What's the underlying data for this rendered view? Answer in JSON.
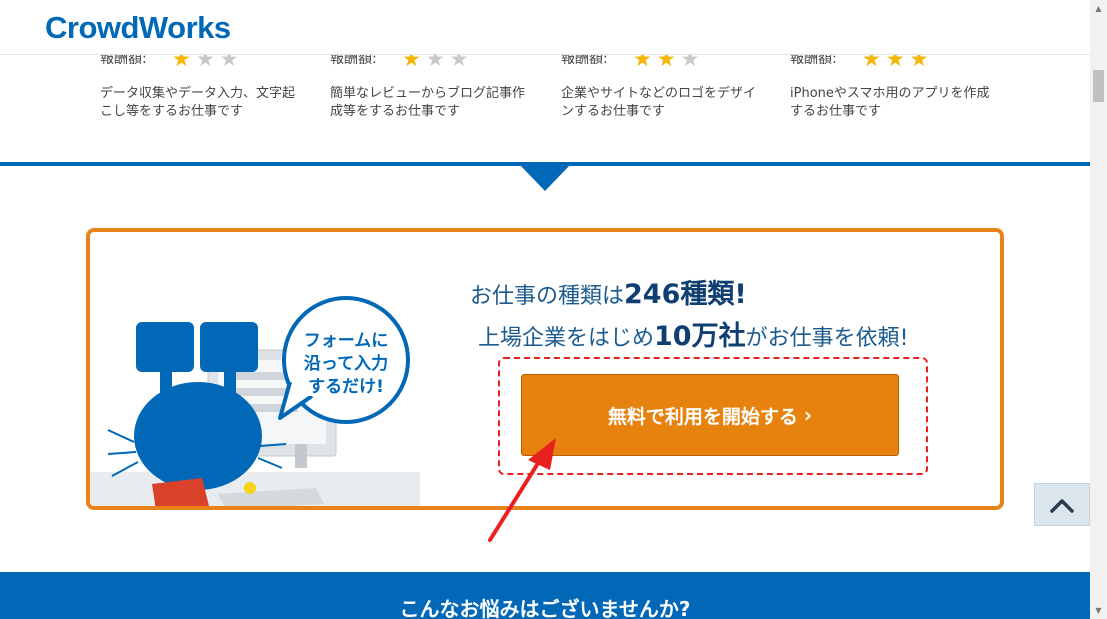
{
  "header": {
    "logo_text": "CrowdWorks"
  },
  "levels": [
    {
      "label": "報酬額:",
      "stars_on": 1,
      "stars_total": 3,
      "description": "データ収集やデータ入力、文字起こし等をするお仕事です"
    },
    {
      "label": "報酬額:",
      "stars_on": 1,
      "stars_total": 3,
      "description": "簡単なレビューからブログ記事作成等をするお仕事です"
    },
    {
      "label": "報酬額:",
      "stars_on": 2,
      "stars_total": 3,
      "description": "企業やサイトなどのロゴをデザインするお仕事です"
    },
    {
      "label": "報酬額:",
      "stars_on": 3,
      "stars_total": 3,
      "description": "iPhoneやスマホ用のアプリを作成するお仕事です"
    }
  ],
  "cta": {
    "bubble_line1": "フォームに",
    "bubble_line2": "沿って入力",
    "bubble_line3": "するだけ!",
    "line1_pre": "お仕事の種類は",
    "line1_em": "246種類!",
    "line2_pre": "上場企業をはじめ",
    "line2_em": "10万社",
    "line2_post": "がお仕事を依頼!",
    "button_label": "無料で利用を開始する",
    "button_chevron": "›"
  },
  "bottom": {
    "heading": "こんなお悩みはございませんか?"
  },
  "icons": {
    "star": "star-icon",
    "chevron": "chevron-right-icon",
    "scroll_top": "chevron-up-icon"
  },
  "colors": {
    "brand_blue": "#0068b7",
    "cta_orange": "#e8820e",
    "box_orange": "#e8821a",
    "star_on": "#f7b500",
    "star_off": "#c8c8c8",
    "annotation_red": "#e82020"
  }
}
